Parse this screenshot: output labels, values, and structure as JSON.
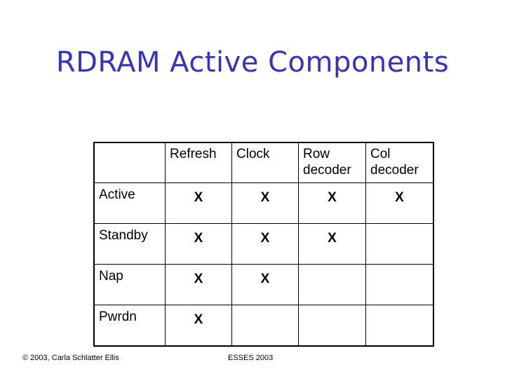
{
  "slide": {
    "title": "RDRAM Active Components",
    "title_color": "#3333bb"
  },
  "table": {
    "headers": [
      "",
      "Refresh",
      "Clock",
      "Row decoder",
      "Col decoder"
    ],
    "rows": [
      {
        "label": "Active",
        "cells": [
          "X",
          "X",
          "X",
          "X"
        ]
      },
      {
        "label": "Standby",
        "cells": [
          "X",
          "X",
          "X",
          ""
        ]
      },
      {
        "label": "Nap",
        "cells": [
          "X",
          "X",
          "",
          ""
        ]
      },
      {
        "label": "Pwrdn",
        "cells": [
          "X",
          "",
          "",
          ""
        ]
      }
    ]
  },
  "footer": {
    "copyright": "© 2003, Carla Schlatter Ellis",
    "event": "ESSES 2003"
  }
}
